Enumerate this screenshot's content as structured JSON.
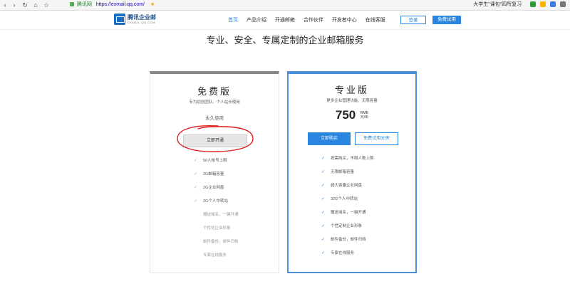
{
  "browser": {
    "security_label": "腾讯网",
    "url": "https://exmail.qq.com/",
    "search_text": "大学生\"课包\"四所复习"
  },
  "header": {
    "logo_text": "腾讯企业邮",
    "logo_sub": "EXMAIL.QQ.COM",
    "menu": [
      "首页",
      "产品介绍",
      "开通邮箱",
      "合作伙伴",
      "开发者中心",
      "在线客服"
    ],
    "login_label": "登录",
    "trial_label": "免费试用"
  },
  "page_title": "专业、安全、专属定制的企业邮箱服务",
  "free": {
    "name": "免费版",
    "desc": "专为初创团队、个人站长使用",
    "forever": "永久使用",
    "open_label": "立即开通",
    "features": [
      "50人帐号上限",
      "2G邮箱容量",
      "2G企业网盘",
      "2G个人中转站"
    ],
    "missing": [
      "赠送域名，一键开通",
      "个性化企业形象",
      "邮件备份，邮件归档",
      "专家在线服务"
    ]
  },
  "pro": {
    "name": "专业版",
    "desc": "更多企业管理功能、无限容量",
    "price": "750",
    "price_unit_top": "RMB",
    "price_unit_bottom": "元/年",
    "buy_label": "立即购买",
    "try_label": "免费试用30天",
    "features": [
      "按需购买，不限人数上限",
      "无限邮箱容量",
      "超大容量企业网盘",
      "32G个人中转站",
      "赠送域名，一键开通",
      "个性定制企业形象",
      "邮件备份，邮件归档",
      "专家在线服务"
    ]
  },
  "colors": {
    "accent": "#2985e0",
    "annotation": "#e02020"
  },
  "icons": {
    "check": "check-icon"
  }
}
